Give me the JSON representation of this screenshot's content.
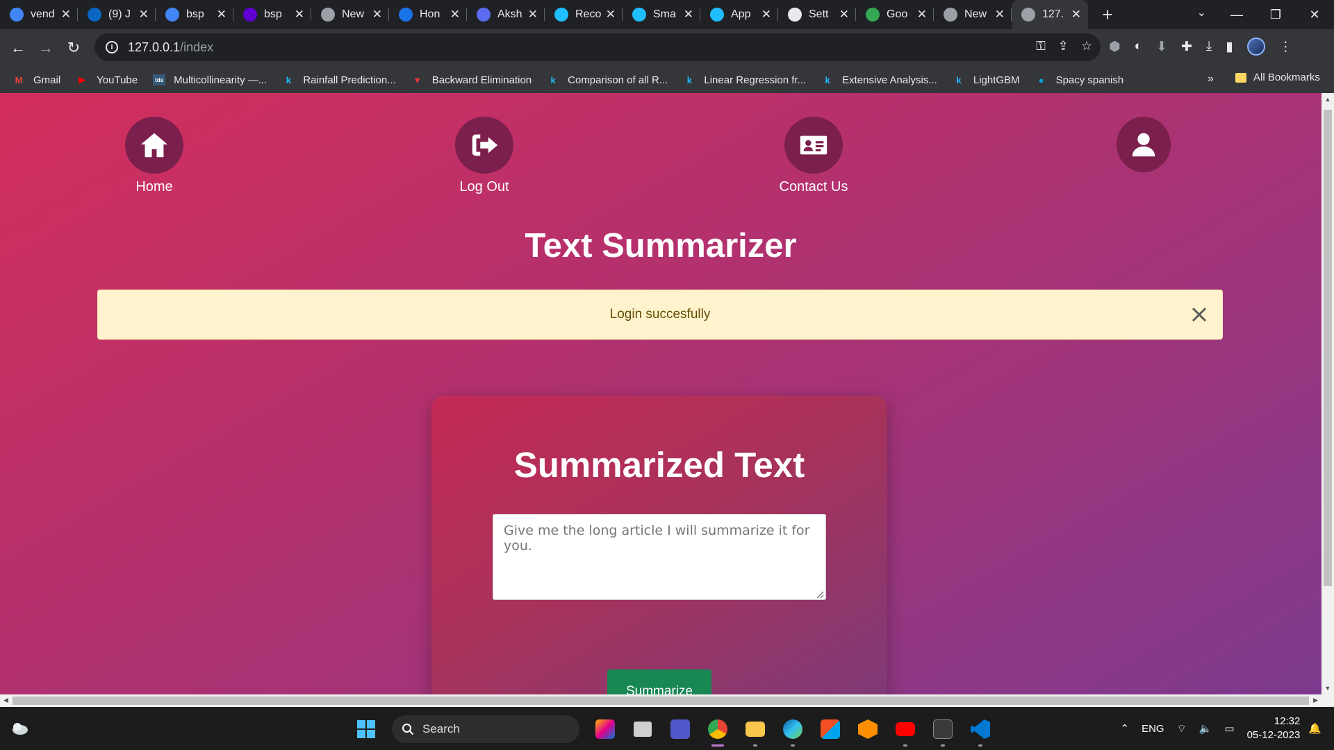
{
  "browser": {
    "tabs": [
      {
        "title": "vend",
        "favicon": "google-icon",
        "color": "#4285f4"
      },
      {
        "title": "(9) J",
        "favicon": "linkedin-icon",
        "color": "#0a66c2"
      },
      {
        "title": "bsp",
        "favicon": "google-icon",
        "color": "#4285f4"
      },
      {
        "title": "bsp",
        "favicon": "yahoo-icon",
        "color": "#6001d2"
      },
      {
        "title": "New",
        "favicon": "chrome-icon",
        "color": "#9aa0a6"
      },
      {
        "title": "Hon",
        "favicon": "c-icon",
        "color": "#1a73e8"
      },
      {
        "title": "Aksh",
        "favicon": "app-icon",
        "color": "#5b6cf0"
      },
      {
        "title": "Reco",
        "favicon": "kaggle-k-icon",
        "color": "#20beff"
      },
      {
        "title": "Sma",
        "favicon": "kaggle-k-icon",
        "color": "#20beff"
      },
      {
        "title": "App",
        "favicon": "kaggle-k-icon",
        "color": "#20beff"
      },
      {
        "title": "Sett",
        "favicon": "gear-icon",
        "color": "#e8eaed"
      },
      {
        "title": "Goo",
        "favicon": "google-lens-icon",
        "color": "#34a853"
      },
      {
        "title": "New",
        "favicon": "chrome-icon",
        "color": "#9aa0a6"
      },
      {
        "title": "127.",
        "favicon": "globe-icon",
        "color": "#9aa0a6",
        "active": true
      }
    ],
    "url_host": "127.0.0.1",
    "url_path": "/index",
    "bookmarks": [
      {
        "label": "Gmail",
        "icon": "gmail-icon",
        "color": "#ea4335"
      },
      {
        "label": "YouTube",
        "icon": "youtube-icon",
        "color": "#ff0000"
      },
      {
        "label": "Multicollinearity —...",
        "icon": "tds-icon",
        "color": "#355876"
      },
      {
        "label": "Rainfall Prediction...",
        "icon": "kaggle-k-icon",
        "color": "#20beff"
      },
      {
        "label": "Backward Elimination",
        "icon": "triangle-icon",
        "color": "#e53935"
      },
      {
        "label": "Comparison of all R...",
        "icon": "kaggle-k-icon",
        "color": "#20beff"
      },
      {
        "label": "Linear Regression fr...",
        "icon": "kaggle-k-icon",
        "color": "#20beff"
      },
      {
        "label": "Extensive Analysis...",
        "icon": "kaggle-k-icon",
        "color": "#20beff"
      },
      {
        "label": "LightGBM",
        "icon": "kaggle-k-icon",
        "color": "#20beff"
      },
      {
        "label": "Spacy spanish",
        "icon": "spacy-icon",
        "color": "#09a3d5"
      }
    ],
    "bookmarks_more": "»",
    "all_bookmarks": "All Bookmarks"
  },
  "page": {
    "nav": {
      "home": "Home",
      "logout": "Log Out",
      "contact": "Contact Us"
    },
    "title": "Text Summarizer",
    "alert": "Login succesfully",
    "card_title": "Summarized Text",
    "textarea_placeholder": "Give me the long article I will summarize it for you.",
    "button": "Summarize"
  },
  "taskbar": {
    "search": "Search",
    "lang": "ENG",
    "time": "12:32",
    "date": "05-12-2023"
  },
  "colors": {
    "page_gradient_start": "#d32f5c",
    "page_gradient_end": "#7c3a8e",
    "nav_circle": "#7b1f4d",
    "alert_bg": "#fff3cd",
    "button": "#198754"
  }
}
